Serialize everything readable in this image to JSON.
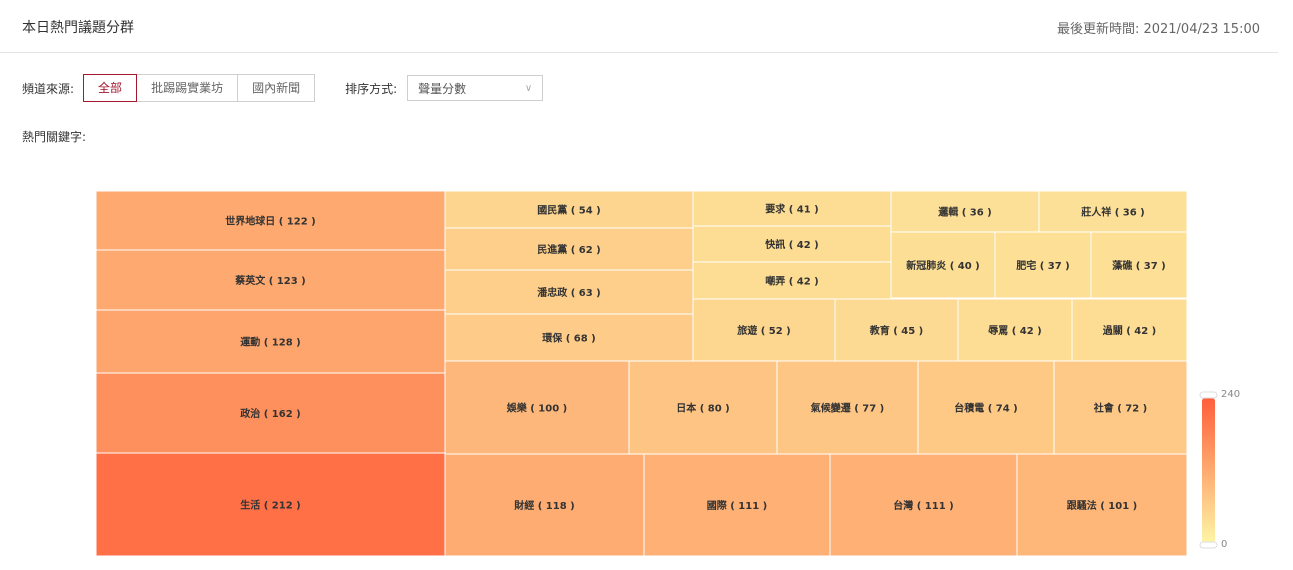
{
  "header": {
    "title": "本日熱門議題分群",
    "update_time": "最後更新時間: 2021/04/23 15:00"
  },
  "filters": {
    "source_label": "頻道來源:",
    "sources": [
      {
        "label": "全部",
        "active": true
      },
      {
        "label": "批踢踢實業坊",
        "active": false
      },
      {
        "label": "國內新聞",
        "active": false
      }
    ],
    "sort_label": "排序方式:",
    "sort_value": "聲量分數",
    "keyword_label": "熱門關鍵字:"
  },
  "colors": {
    "min": "#fdf7a7",
    "max": "#ff5e3a"
  },
  "chart_data": {
    "type": "treemap",
    "value_range": [
      0,
      240
    ],
    "legend": {
      "min_label": "0",
      "max_label": "240"
    },
    "items": [
      {
        "label": "世界地球日 ( 122 )",
        "value": 122
      },
      {
        "label": "蔡英文 ( 123 )",
        "value": 123
      },
      {
        "label": "運動 ( 128 )",
        "value": 128
      },
      {
        "label": "政治 ( 162 )",
        "value": 162
      },
      {
        "label": "生活 ( 212 )",
        "value": 212
      },
      {
        "label": "國民黨 ( 54 )",
        "value": 54
      },
      {
        "label": "民進黨 ( 62 )",
        "value": 62
      },
      {
        "label": "潘忠政 ( 63 )",
        "value": 63
      },
      {
        "label": "環保 ( 68 )",
        "value": 68
      },
      {
        "label": "要求 ( 41 )",
        "value": 41
      },
      {
        "label": "快訊 ( 42 )",
        "value": 42
      },
      {
        "label": "嘲弄 ( 42 )",
        "value": 42
      },
      {
        "label": "邏輯 ( 36 )",
        "value": 36
      },
      {
        "label": "莊人祥 ( 36 )",
        "value": 36
      },
      {
        "label": "新冠肺炎 ( 40 )",
        "value": 40
      },
      {
        "label": "肥宅 ( 37 )",
        "value": 37
      },
      {
        "label": "藻礁 ( 37 )",
        "value": 37
      },
      {
        "label": "旅遊 ( 52 )",
        "value": 52
      },
      {
        "label": "教育 ( 45 )",
        "value": 45
      },
      {
        "label": "辱罵 ( 42 )",
        "value": 42
      },
      {
        "label": "過關 ( 42 )",
        "value": 42
      },
      {
        "label": "娛樂 ( 100 )",
        "value": 100
      },
      {
        "label": "日本 ( 80 )",
        "value": 80
      },
      {
        "label": "氣候變遷 ( 77 )",
        "value": 77
      },
      {
        "label": "台積電 ( 74 )",
        "value": 74
      },
      {
        "label": "社會 ( 72 )",
        "value": 72
      },
      {
        "label": "財經 ( 118 )",
        "value": 118
      },
      {
        "label": "國際 ( 111 )",
        "value": 111
      },
      {
        "label": "台灣 ( 111 )",
        "value": 111
      },
      {
        "label": "跟騷法 ( 101 )",
        "value": 101
      }
    ]
  }
}
